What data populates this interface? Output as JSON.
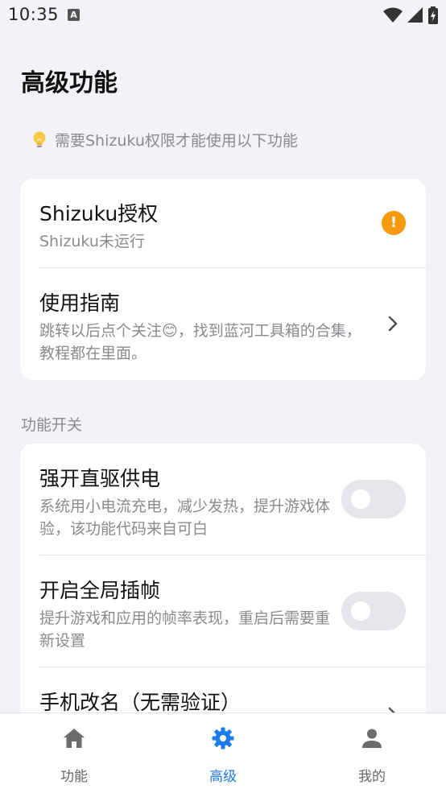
{
  "status_bar": {
    "time": "10:35",
    "notification_letter": "A"
  },
  "page": {
    "title": "高级功能",
    "hint": "需要Shizuku权限才能使用以下功能"
  },
  "shizuku_card": {
    "auth_title": "Shizuku授权",
    "auth_status": "Shizuku未运行",
    "warning_glyph": "!",
    "guide_title": "使用指南",
    "guide_desc": "跳转以后点个关注😊，找到蓝河工具箱的合集，教程都在里面。"
  },
  "section": {
    "label": "功能开关"
  },
  "features": [
    {
      "title": "强开直驱供电",
      "desc": "系统用小电流充电，减少发热，提升游戏体验，该功能代码来自可白",
      "enabled": false
    },
    {
      "title": "开启全局插帧",
      "desc": "提升游戏和应用的帧率表现，重启后需要重新设置",
      "enabled": false
    },
    {
      "title": "手机改名（无需验证）"
    }
  ],
  "bottom_nav": {
    "items": [
      {
        "label": "功能",
        "icon": "home-icon",
        "active": false
      },
      {
        "label": "高级",
        "icon": "gear-icon",
        "active": true
      },
      {
        "label": "我的",
        "icon": "person-icon",
        "active": false
      }
    ]
  },
  "colors": {
    "accent": "#1f7aec",
    "warning": "#f59a0c",
    "inactive_nav": "#666666",
    "background": "#f2f2f7"
  }
}
